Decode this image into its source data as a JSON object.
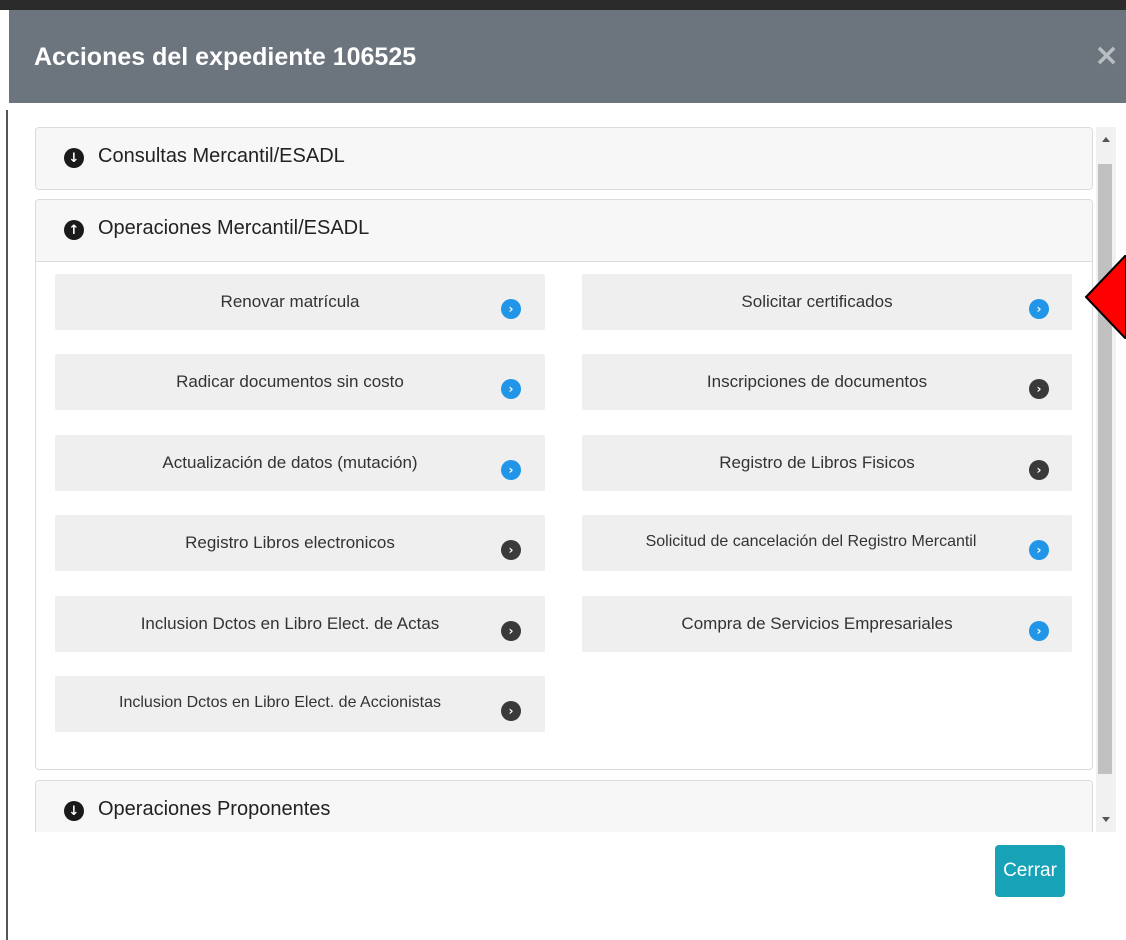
{
  "modal": {
    "title": "Acciones del expediente 106525",
    "close_symbol": "×",
    "footer_button": "Cerrar"
  },
  "panels": [
    {
      "title": "Consultas Mercantil/ESADL",
      "icon": "circle-arrow-down-icon"
    },
    {
      "title": "Operaciones Mercantil/ESADL",
      "icon": "circle-arrow-up-icon"
    },
    {
      "title": "Operaciones Proponentes",
      "icon": "circle-arrow-down-icon"
    }
  ],
  "operations": [
    {
      "label": "Renovar matrícula",
      "icon_color": "blue"
    },
    {
      "label": "Solicitar certificados",
      "icon_color": "blue"
    },
    {
      "label": "Radicar documentos sin costo",
      "icon_color": "blue"
    },
    {
      "label": "Inscripciones de documentos",
      "icon_color": "gray"
    },
    {
      "label": "Actualización de datos (mutación)",
      "icon_color": "blue"
    },
    {
      "label": "Registro de Libros Fisicos",
      "icon_color": "gray"
    },
    {
      "label": "Registro Libros electronicos",
      "icon_color": "gray"
    },
    {
      "label": "Solicitud de cancelación del Registro Mercantil",
      "icon_color": "blue"
    },
    {
      "label": "Inclusion Dctos en Libro Elect. de Actas",
      "icon_color": "gray"
    },
    {
      "label": "Compra de Servicios Empresariales",
      "icon_color": "blue"
    },
    {
      "label": "Inclusion Dctos en Libro Elect. de Accionistas",
      "icon_color": "gray"
    }
  ],
  "colors": {
    "header_bg": "#6c757d",
    "blue_icon": "#2196e8",
    "gray_icon": "#3a3a3a",
    "button_bg": "#17a2b8",
    "pointer": "#ff0000"
  }
}
